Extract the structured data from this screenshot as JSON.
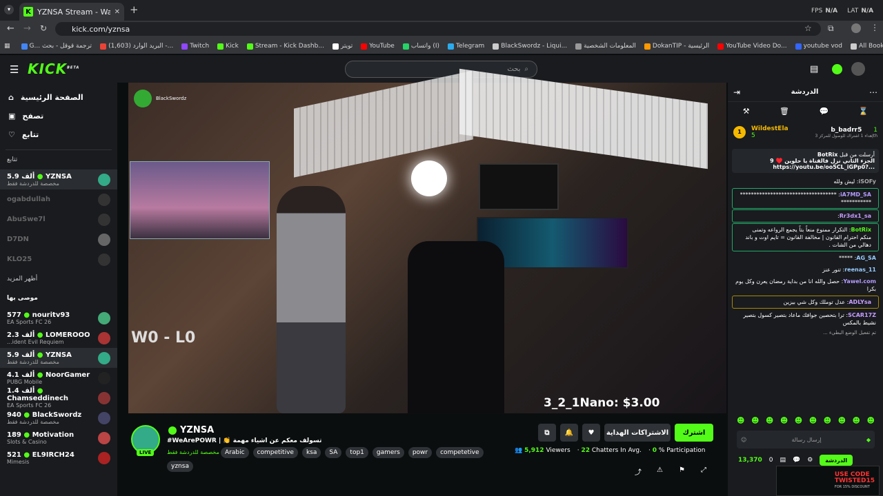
{
  "browser": {
    "tab_title": "YZNSA Stream - Watch Live on",
    "url": "kick.com/yznsa",
    "fps_label": "FPS",
    "fps_value": "N/A",
    "lat_label": "LAT",
    "lat_value": "N/A",
    "bookmarks": [
      "G... ترجمة قوقل - بحث",
      "(1,603) البريد الوارد -...",
      "Twitch",
      "Kick",
      "Stream - Kick Dashb...",
      "تويتر",
      "YouTube",
      "واتساب (I)",
      "Telegram",
      "BlackSwordz - Liqui...",
      "المعلومات الشخصية",
      "DokanTIP - الرئيسية",
      "YouTube Video Do...",
      "youtube vod"
    ],
    "all_bookmarks": "All Bookmarks"
  },
  "header": {
    "logo": "KICK",
    "beta": "BETA",
    "search_placeholder": "بحث"
  },
  "sidebar": {
    "nav": [
      {
        "label": "الصفحة الرئيسية",
        "icon": "home-icon"
      },
      {
        "label": "تصفح",
        "icon": "browse-icon"
      },
      {
        "label": "تتابع",
        "icon": "heart-icon"
      }
    ],
    "following_header": "تتابع",
    "following": [
      {
        "name": "YZNSA",
        "count": "5.9 ألف",
        "sub": "مخصصة للدردشة فقط",
        "live": true
      },
      {
        "name": "ogabdullah",
        "count": "",
        "sub": "",
        "live": false
      },
      {
        "name": "AbuSwe7l",
        "count": "",
        "sub": "",
        "live": false
      },
      {
        "name": "D7DN",
        "count": "",
        "sub": "",
        "live": false
      },
      {
        "name": "KLO25",
        "count": "",
        "sub": "",
        "live": false
      }
    ],
    "show_more": "أظهر المزيد",
    "recommended_header": "موصى بها",
    "recommended": [
      {
        "name": "nouritv93",
        "count": "577",
        "sub": "EA Sports FC 26"
      },
      {
        "name": "LOMEROOO",
        "count": "2.3 ألف",
        "sub": "...ident Evil Requiem"
      },
      {
        "name": "YZNSA",
        "count": "5.9 ألف",
        "sub": "مخصصة للدردشة فقط"
      },
      {
        "name": "NoorGamer",
        "count": "4.1 ألف",
        "sub": "PUBG Mobile"
      },
      {
        "name": "Chamseddinech",
        "count": "1.4 ألف",
        "sub": "EA Sports FC 26"
      },
      {
        "name": "BlackSwordz",
        "count": "940",
        "sub": "مخصصة للدردشة فقط"
      },
      {
        "name": "Motivation",
        "count": "189",
        "sub": "Slots & Casino"
      },
      {
        "name": "EL9IRCH24",
        "count": "521",
        "sub": "Mimesis"
      }
    ]
  },
  "video": {
    "overlay_channel": "BlackSwordz",
    "tip_text": "3_2_1Nano: $3.00",
    "score_text": "W0 - L0"
  },
  "stream": {
    "channel": "YZNSA",
    "live_badge": "LIVE",
    "title": "#WeArePOWR | 👏 تسولف معكم عن اشياء مهمة",
    "category": "مخصصة للدردشة فقط",
    "tags": [
      "Arabic",
      "competitive",
      "ksa",
      "SA",
      "top1",
      "gamers",
      "powr",
      "competetive",
      "yznsa"
    ],
    "subscribe_label": "اشترك",
    "gift_label": "الاشتراكات الهداية",
    "viewers": "5,912",
    "viewers_label": "Viewers",
    "chatters": "22",
    "chatters_label": "Chatters In Avg.",
    "participation": "0",
    "participation_label": "% Participation"
  },
  "chat": {
    "title": "الدردشة",
    "top_gifters": [
      {
        "name": "b_badrr5",
        "rank": "1",
        "sub": "إهداء 1 اشتراك للوصول للمركز",
        "place": "3th"
      },
      {
        "name": "WildestEla",
        "rank": "1",
        "count": "5"
      }
    ],
    "pinned": {
      "by": "BotRix",
      "header": "أرسلت من قبل",
      "text": "الجزء الثاني نزل فالقناة يا حلوين ♥️ 9",
      "link": "https://youtu.be/oo5CL_iGPp0?..."
    },
    "messages": [
      {
        "user": "iSOFy",
        "text": "ليش ولله",
        "color": "#aaa"
      },
      {
        "user": "iA7MD_SA",
        "text": "**********************************************",
        "color": "#b59cff"
      },
      {
        "user": "Rr3dx1_sa",
        "text": "",
        "color": "#c79cff"
      },
      {
        "user": "BotRix",
        "text": "التكرار ممنوع منعاً بتاً يجمع الرواعه وتمنى منكم احترام القانون | مخالفة القانون = تايم اوت و باند دهالي من الشات .",
        "color": "#53fc18"
      },
      {
        "user": "AG_SA",
        "text": "*****",
        "color": "#9cf"
      },
      {
        "user": "reenas_11",
        "text": "تنور عنز",
        "color": "#9cf"
      },
      {
        "user": "Yawel.com",
        "text": "حصل والله انا من بداية رمضان يعرن وكل يوم بكرا",
        "color": "#b59cff"
      },
      {
        "user": "ADLYsa",
        "text": "عدل توملك وكل شي بيزين",
        "color": "#c9a0ff"
      },
      {
        "user": "SCAR17Z",
        "text": "ترا بتحصين جوافك ماعاد بتصير كسول بتصير نشيط بالمكس",
        "color": "#c79cff"
      }
    ],
    "mode_note": "تم تفعيل الوضع البطيء ...",
    "input_placeholder": "إرسال رسالة",
    "points": "13,370",
    "zero": "0",
    "send_label": "الدردشة",
    "ad_text": "USE CODE",
    "ad_code": "TWISTED15",
    "ad_sub": "FOR 15% DISCOUNT"
  }
}
